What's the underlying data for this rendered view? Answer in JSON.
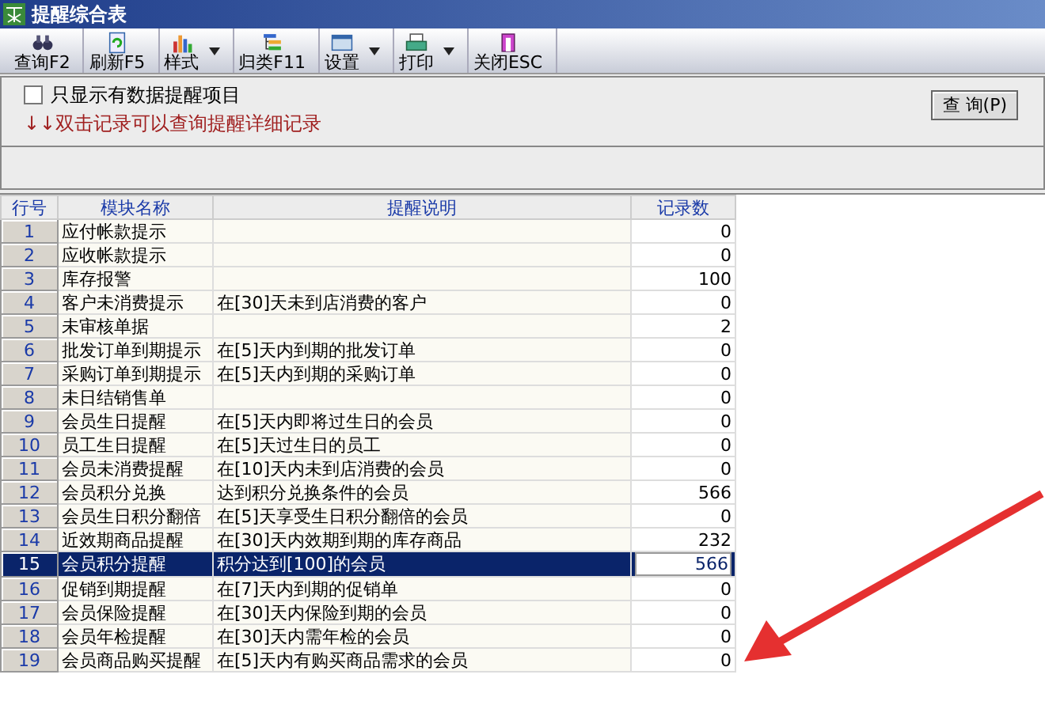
{
  "window": {
    "title": "提醒综合表"
  },
  "toolbar": [
    {
      "label": "查询F2",
      "has_menu": false
    },
    {
      "label": "刷新F5",
      "has_menu": false
    },
    {
      "label": "样式",
      "has_menu": true
    },
    {
      "label": "归类F11",
      "has_menu": false
    },
    {
      "label": "设置",
      "has_menu": true
    },
    {
      "label": "打印",
      "has_menu": true
    },
    {
      "label": "关闭ESC",
      "has_menu": false
    }
  ],
  "filter": {
    "label": "只显示有数据提醒项目",
    "checked": false
  },
  "hint": "↓↓双击记录可以查询提醒详细记录",
  "query_button": "查 询(P)",
  "table": {
    "columns": [
      "行号",
      "模块名称",
      "提醒说明",
      "记录数"
    ],
    "rows": [
      {
        "no": "1",
        "module": "应付帐款提示",
        "desc": "",
        "count": "0",
        "selected": false
      },
      {
        "no": "2",
        "module": "应收帐款提示",
        "desc": "",
        "count": "0",
        "selected": false
      },
      {
        "no": "3",
        "module": "库存报警",
        "desc": "",
        "count": "100",
        "selected": false
      },
      {
        "no": "4",
        "module": "客户未消费提示",
        "desc": "在[30]天未到店消费的客户",
        "count": "0",
        "selected": false
      },
      {
        "no": "5",
        "module": "未审核单据",
        "desc": "",
        "count": "2",
        "selected": false
      },
      {
        "no": "6",
        "module": "批发订单到期提示",
        "desc": "在[5]天内到期的批发订单",
        "count": "0",
        "selected": false
      },
      {
        "no": "7",
        "module": "采购订单到期提示",
        "desc": "在[5]天内到期的采购订单",
        "count": "0",
        "selected": false
      },
      {
        "no": "8",
        "module": "未日结销售单",
        "desc": "",
        "count": "0",
        "selected": false
      },
      {
        "no": "9",
        "module": "会员生日提醒",
        "desc": "在[5]天内即将过生日的会员",
        "count": "0",
        "selected": false
      },
      {
        "no": "10",
        "module": "员工生日提醒",
        "desc": "在[5]天过生日的员工",
        "count": "0",
        "selected": false
      },
      {
        "no": "11",
        "module": "会员未消费提醒",
        "desc": "在[10]天内未到店消费的会员",
        "count": "0",
        "selected": false
      },
      {
        "no": "12",
        "module": "会员积分兑换",
        "desc": "达到积分兑换条件的会员",
        "count": "566",
        "selected": false
      },
      {
        "no": "13",
        "module": "会员生日积分翻倍",
        "desc": "在[5]天享受生日积分翻倍的会员",
        "count": "0",
        "selected": false
      },
      {
        "no": "14",
        "module": "近效期商品提醒",
        "desc": "在[30]天内效期到期的库存商品",
        "count": "232",
        "selected": false
      },
      {
        "no": "15",
        "module": "会员积分提醒",
        "desc": "积分达到[100]的会员",
        "count": "566",
        "selected": true
      },
      {
        "no": "16",
        "module": "促销到期提醒",
        "desc": "在[7]天内到期的促销单",
        "count": "0",
        "selected": false
      },
      {
        "no": "17",
        "module": "会员保险提醒",
        "desc": "在[30]天内保险到期的会员",
        "count": "0",
        "selected": false
      },
      {
        "no": "18",
        "module": "会员年检提醒",
        "desc": "在[30]天内需年检的会员",
        "count": "0",
        "selected": false
      },
      {
        "no": "19",
        "module": "会员商品购买提醒",
        "desc": "在[5]天内有购买商品需求的会员",
        "count": "0",
        "selected": false
      }
    ]
  }
}
